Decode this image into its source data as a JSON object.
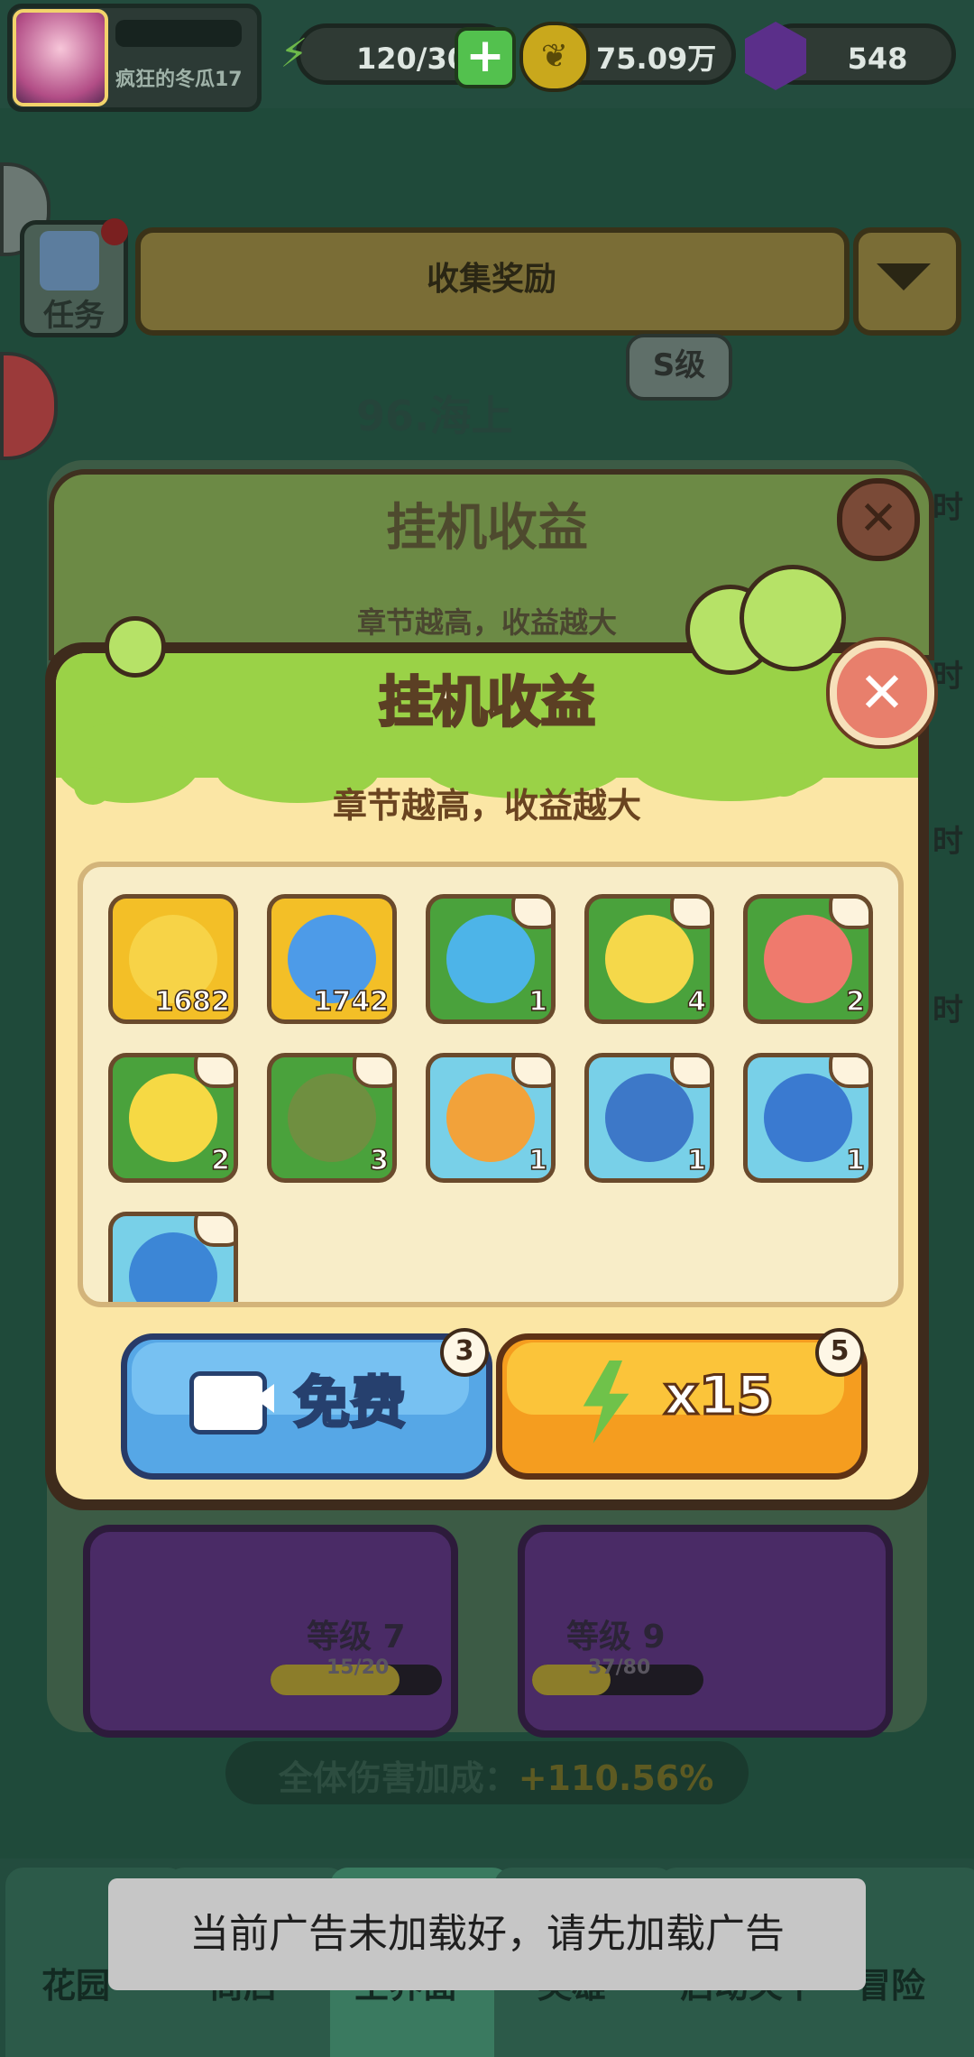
{
  "topbar": {
    "player_name": "疯狂的冬瓜17",
    "energy": "120/30",
    "gold": "75.09万",
    "gems": "548"
  },
  "background": {
    "task_label": "任务",
    "collect_label": "收集奖励",
    "chapter_title": "96.海上",
    "rank_badge": "S级",
    "side_time": "时",
    "upper_modal_title": "挂机收益",
    "upper_modal_subtitle": "章节越高，收益越大",
    "card1_level": "等级 7",
    "card1_progress": "15/20",
    "card1_fill": 0.75,
    "card2_level": "等级 9",
    "card2_progress": "37/80",
    "card2_fill": 0.46,
    "damage_label": "全体伤害加成：",
    "damage_value": "+110.56%"
  },
  "modal": {
    "title": "挂机收益",
    "subtitle": "章节越高，收益越大",
    "close_icon": "✕",
    "items": [
      {
        "name": "gold-leaf-coin",
        "style": "gold",
        "count": "1682",
        "art": "#f7d347"
      },
      {
        "name": "blue-star-gem",
        "style": "gold",
        "count": "1742",
        "art": "#4d9be8"
      },
      {
        "name": "king-plant-card",
        "style": "green",
        "count": "1",
        "art": "#4db4e8"
      },
      {
        "name": "armored-pea-card",
        "style": "green",
        "count": "4",
        "art": "#f5d84a"
      },
      {
        "name": "goggle-plant-card",
        "style": "green",
        "count": "2",
        "art": "#ef7a6d"
      },
      {
        "name": "sunflower-card",
        "style": "green",
        "count": "2",
        "art": "#f6d944"
      },
      {
        "name": "pharaoh-plant-card",
        "style": "green",
        "count": "3",
        "art": "#6f8f40"
      },
      {
        "name": "lotus-plant-card",
        "style": "blue",
        "count": "1",
        "art": "#f2a23a"
      },
      {
        "name": "mecha-girl-card",
        "style": "blue",
        "count": "1",
        "art": "#3d78c8"
      },
      {
        "name": "robot-plant-card",
        "style": "blue",
        "count": "1",
        "art": "#3a7ad0"
      },
      {
        "name": "crown-plant-card",
        "style": "blue",
        "count": "",
        "art": "#3c86d6"
      }
    ],
    "free_button": {
      "label": "免费",
      "badge": "3"
    },
    "energy_button": {
      "label": "x15",
      "badge": "5"
    }
  },
  "nav": {
    "items": [
      "花园",
      "商店",
      "主界面",
      "英雄",
      "启动关卡",
      "冒险"
    ]
  },
  "toast": "当前广告未加载好，请先加载广告"
}
